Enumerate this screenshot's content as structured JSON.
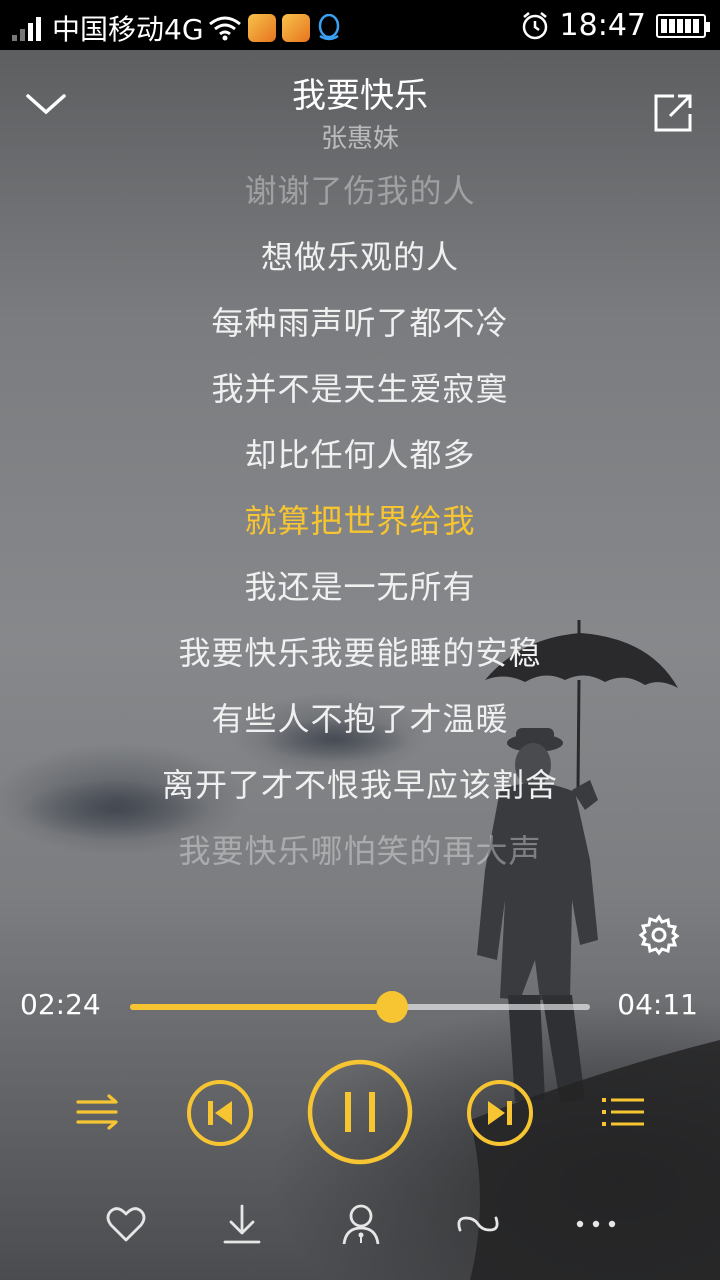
{
  "status_bar": {
    "carrier": "中国移动4G",
    "time": "18:47",
    "icons": [
      "signal-icon",
      "wifi-icon",
      "app-notification-icon",
      "app-notification-icon",
      "qq-icon",
      "alarm-icon",
      "battery-icon"
    ]
  },
  "header": {
    "song_title": "我要快乐",
    "artist": "张惠妹",
    "back_icon": "chevron-down-icon",
    "share_icon": "share-icon"
  },
  "lyrics": [
    {
      "text": "谢谢了伤我的人",
      "state": "faded"
    },
    {
      "text": "想做乐观的人",
      "state": "normal"
    },
    {
      "text": "每种雨声听了都不冷",
      "state": "normal"
    },
    {
      "text": "我并不是天生爱寂寞",
      "state": "normal"
    },
    {
      "text": "却比任何人都多",
      "state": "normal"
    },
    {
      "text": "就算把世界给我",
      "state": "current"
    },
    {
      "text": "我还是一无所有",
      "state": "normal"
    },
    {
      "text": "我要快乐我要能睡的安稳",
      "state": "normal"
    },
    {
      "text": "有些人不抱了才温暖",
      "state": "normal"
    },
    {
      "text": "离开了才不恨我早应该割舍",
      "state": "normal"
    },
    {
      "text": "我要快乐哪怕笑的再大声",
      "state": "faded"
    }
  ],
  "player": {
    "current_time": "02:24",
    "total_time": "04:11",
    "progress": 0.57,
    "state": "playing"
  },
  "colors": {
    "accent": "#f7c531",
    "text": "#ffffff"
  },
  "controls": [
    "shuffle-icon",
    "previous-icon",
    "pause-icon",
    "next-icon",
    "playlist-icon"
  ],
  "actions": [
    "heart-icon",
    "download-icon",
    "singer-icon",
    "loop-icon",
    "more-icon"
  ]
}
